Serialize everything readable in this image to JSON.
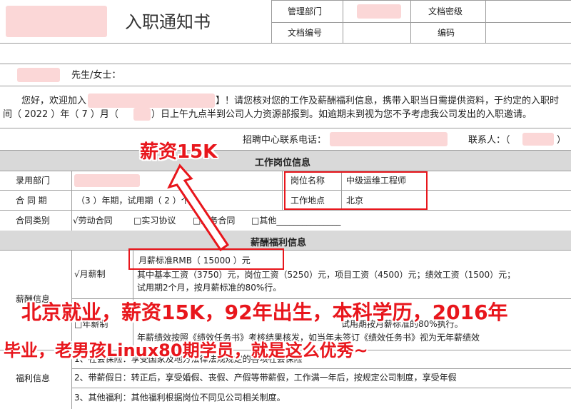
{
  "header": {
    "title": "入职通知书",
    "mgmt_dept_label": "管理部门",
    "doc_level_label": "文档密级",
    "doc_no_label": "文档编号",
    "code_label": "编码"
  },
  "greeting": {
    "salutation": "先生/女士：",
    "line1a": "您好，欢迎加入",
    "line1b": "】！请您核对您的工作及薪酬福利信息，携带入职当日需提供资料，于约定的入职时",
    "line2a": "间（ 2022 ）年（ 7 ）月（",
    "line2b": "）日上午九点半到公司人力资源部报到。如逾期未到视为您不予考虑我公司发出的入职邀请。",
    "contact_phone": "招聘中心联系电话：",
    "contact_person": "联系人：（",
    "contact_close": "）"
  },
  "job": {
    "section_title": "工作岗位信息",
    "dept_label": "录用部门",
    "position_label": "岗位名称",
    "position_value": "中级运维工程师",
    "term_label": "合 同 期",
    "term_value": "（3 ）年期，试用期（ 2 ）个月",
    "location_label": "工作地点",
    "location_value": "北京",
    "contract_type_label": "合同类别",
    "contract_options": [
      "√劳动合同",
      "□实习协议",
      "□劳务合同",
      "□其他_______________"
    ]
  },
  "salary": {
    "section_title": "薪酬福利信息",
    "pay_label": "薪酬信息",
    "monthly_label": "√月薪制",
    "monthly_standard": "月薪标准RMB（ 15000 ）元",
    "breakdown": "其中基本工资（3750）元，岗位工资（5250）元，项目工资（4500）元；绩效工资（1500）元；",
    "probation": "试用期2个月，按月薪标准的80%行。",
    "annual_label": "□年薪制",
    "annual_probation": "试用期按月薪标准的80%执行。",
    "annual_note": "年薪绩效按照《绩效任务书》考核结果核发，如当年未签订《绩效任务书》视为无年薪绩效",
    "benefit_label": "福利信息",
    "benefit_1": "1、社会保险：享受国家及地方法律法规规定的各项社会保险",
    "benefit_2": "2、带薪假日：转正后，享受婚假、丧假、产假等带薪假，工作满一年后，按规定公司制度，享受年假",
    "benefit_3": "3、其他福利：其他福利根据岗位不同见公司相关制度。"
  },
  "annotations": {
    "salary_tag": "薪资15K",
    "summary_line1": "北京就业，薪资15K，92年出生，本科学历，2016年",
    "summary_line2": "毕业，老男孩Linux80期学员，就是这么优秀~",
    "accent_color": "#e8161c"
  }
}
